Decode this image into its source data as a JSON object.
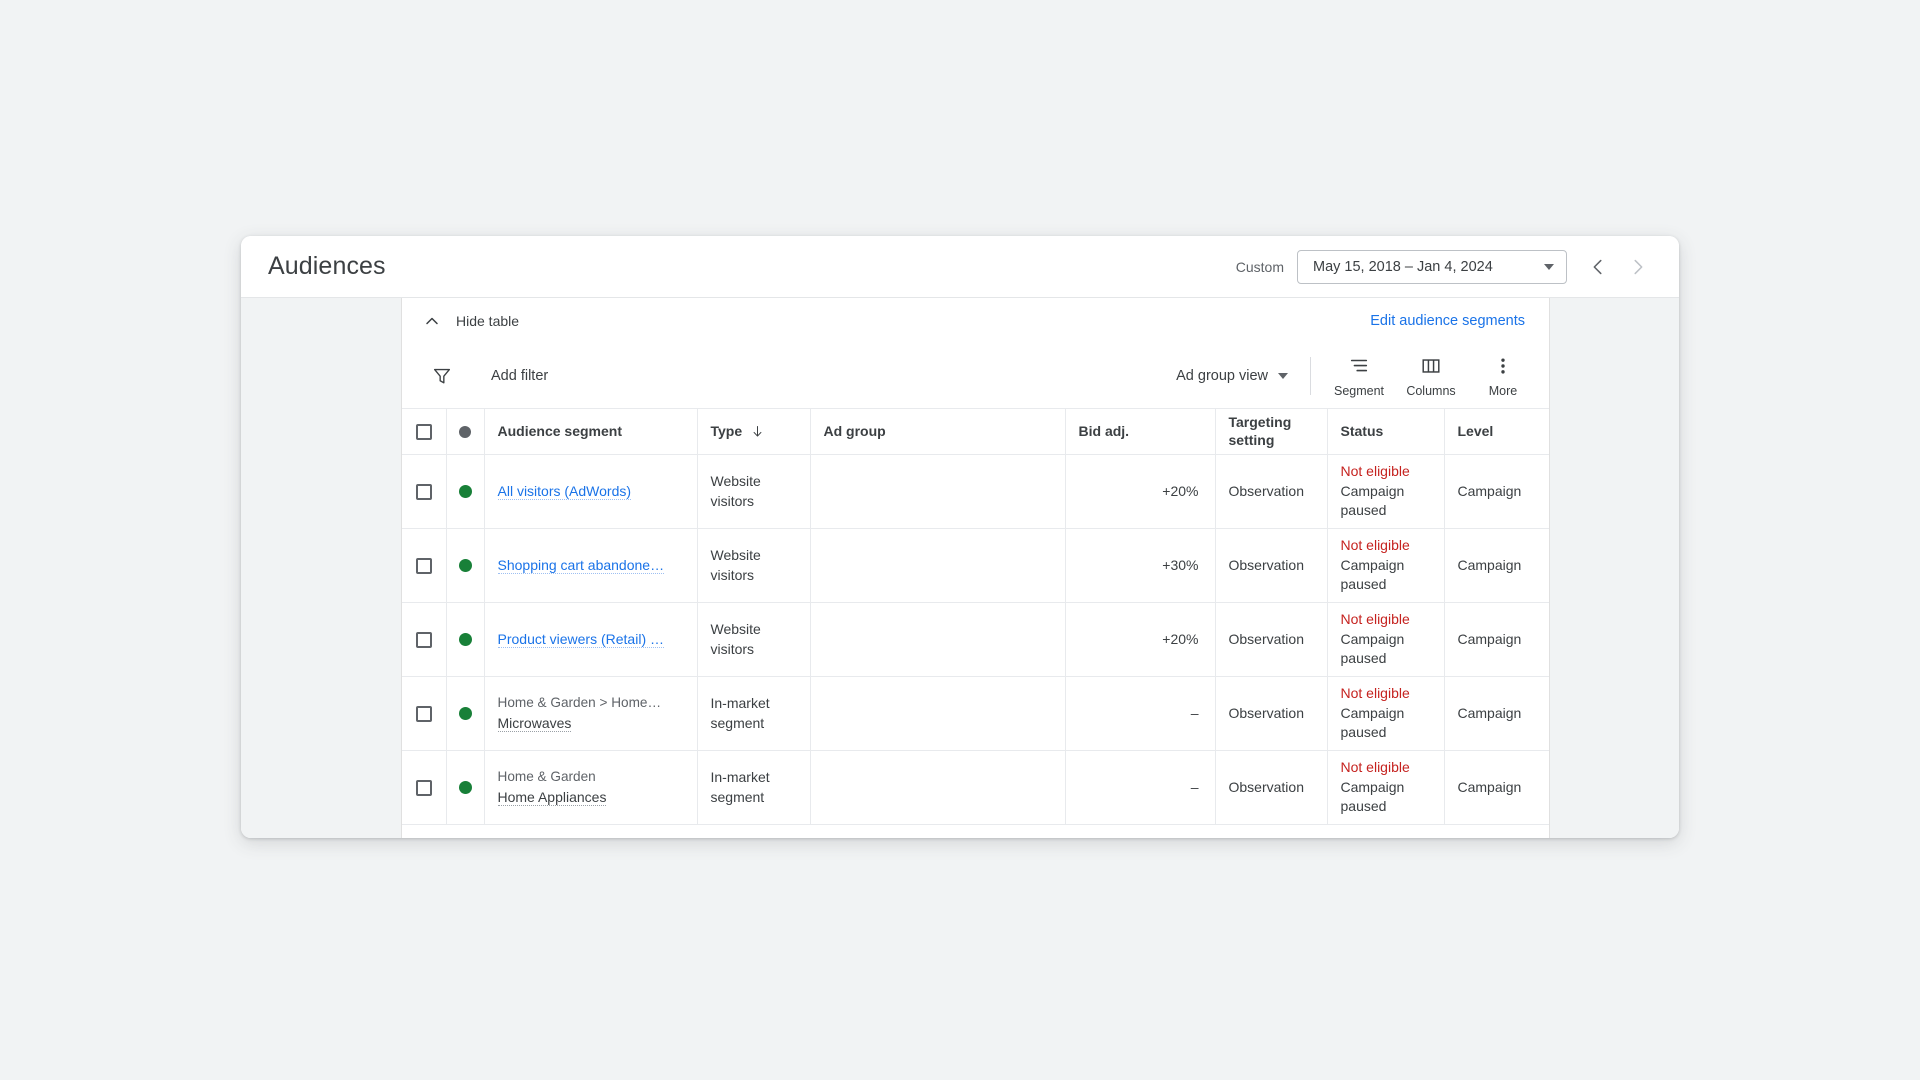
{
  "header": {
    "title": "Audiences",
    "date_preset_label": "Custom",
    "date_range_value": "May 15, 2018 – Jan 4, 2024",
    "prev_icon": "chevron-left-icon",
    "next_icon": "chevron-right-icon",
    "dropdown_icon": "caret-down-icon"
  },
  "table_controls": {
    "hide_table_label": "Hide table",
    "hide_table_icon": "chevron-up-icon",
    "edit_segments_label": "Edit audience segments",
    "filter_icon": "filter-icon",
    "add_filter_label": "Add filter",
    "view_select_label": "Ad group view",
    "tools": [
      {
        "label": "Segment",
        "icon": "segment-icon"
      },
      {
        "label": "Columns",
        "icon": "columns-icon"
      },
      {
        "label": "More",
        "icon": "more-vert-icon"
      }
    ]
  },
  "table": {
    "columns": [
      {
        "key": "check",
        "label": ""
      },
      {
        "key": "dot",
        "label": ""
      },
      {
        "key": "name",
        "label": "Audience segment"
      },
      {
        "key": "type",
        "label": "Type",
        "sort": "descending"
      },
      {
        "key": "adgrp",
        "label": "Ad group"
      },
      {
        "key": "bid",
        "label": "Bid adj."
      },
      {
        "key": "target",
        "label": "Targeting setting"
      },
      {
        "key": "status",
        "label": "Status"
      },
      {
        "key": "level",
        "label": "Level"
      }
    ],
    "rows": [
      {
        "dot_color": "#188038",
        "name_parent": "",
        "name": "All visitors (AdWords)",
        "name_is_link": true,
        "type": "Website visitors",
        "ad_group": "",
        "bid_adj": "+20%",
        "targeting_setting": "Observation",
        "status_primary": "Not eligible",
        "status_secondary": "Campaign paused",
        "level": "Campaign"
      },
      {
        "dot_color": "#188038",
        "name_parent": "",
        "name": "Shopping cart abandone…",
        "name_is_link": true,
        "type": "Website visitors",
        "ad_group": "",
        "bid_adj": "+30%",
        "targeting_setting": "Observation",
        "status_primary": "Not eligible",
        "status_secondary": "Campaign paused",
        "level": "Campaign"
      },
      {
        "dot_color": "#188038",
        "name_parent": "",
        "name": "Product viewers (Retail) …",
        "name_is_link": true,
        "type": "Website visitors",
        "ad_group": "",
        "bid_adj": "+20%",
        "targeting_setting": "Observation",
        "status_primary": "Not eligible",
        "status_secondary": "Campaign paused",
        "level": "Campaign"
      },
      {
        "dot_color": "#188038",
        "name_parent": "Home & Garden > Home…",
        "name": "Microwaves",
        "name_is_link": false,
        "type": "In-market segment",
        "ad_group": "",
        "bid_adj": "–",
        "targeting_setting": "Observation",
        "status_primary": "Not eligible",
        "status_secondary": "Campaign paused",
        "level": "Campaign"
      },
      {
        "dot_color": "#188038",
        "name_parent": "Home & Garden",
        "name": "Home Appliances",
        "name_is_link": false,
        "type": "In-market segment",
        "ad_group": "",
        "bid_adj": "–",
        "targeting_setting": "Observation",
        "status_primary": "Not eligible",
        "status_secondary": "Campaign paused",
        "level": "Campaign"
      }
    ]
  },
  "colors": {
    "link": "#1a73e8",
    "error": "#c5221f",
    "status_ok": "#188038",
    "text": "#3c4043",
    "muted": "#5f6368"
  }
}
